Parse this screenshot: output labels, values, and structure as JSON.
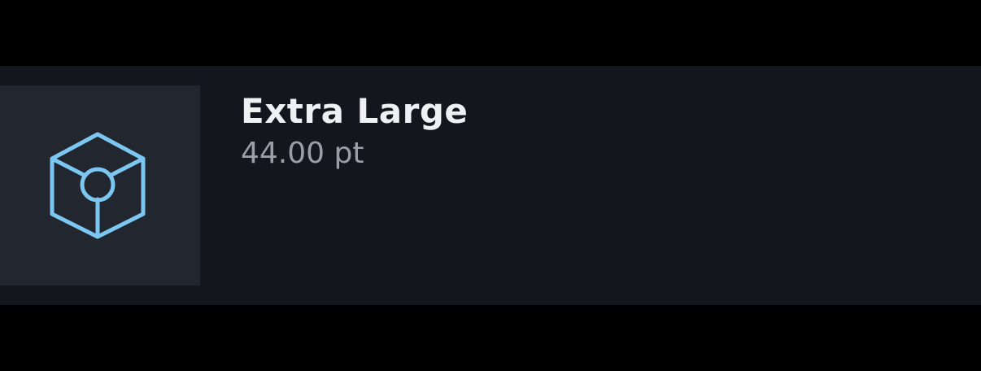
{
  "item": {
    "title": "Extra Large",
    "subtitle": "44.00 pt",
    "icon": "cube-icon",
    "icon_color": "#7cc7f2"
  },
  "colors": {
    "background": "#000000",
    "row_background": "#13161d",
    "thumb_background": "#22262f",
    "title": "#eef0f3",
    "subtitle": "#9a9ea6"
  }
}
